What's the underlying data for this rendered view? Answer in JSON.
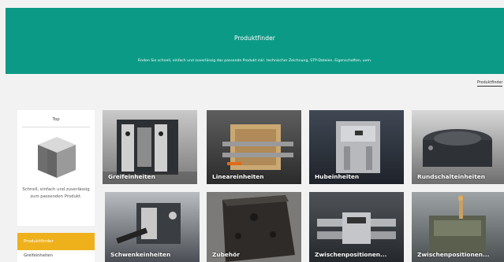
{
  "hero": {
    "title": "Produktfinder",
    "subtitle": "Finden Sie schnell, einfach und zuverlässig das passende Produkt inkl. technischer Zeichnung, STP-Dateien, Eigenschaften, uvm."
  },
  "breadcrumb": {
    "label": "Produktfinder"
  },
  "top_card": {
    "title": "Top",
    "text": "Schnell, einfach und zuverlässig zum passenden Produkt."
  },
  "sidebar": {
    "header": "Produktfinder",
    "items": [
      {
        "label": "Greifeinheiten"
      }
    ]
  },
  "tiles": [
    {
      "label": "Greifeinheiten"
    },
    {
      "label": "Lineareinheiten"
    },
    {
      "label": "Hubeinheiten"
    },
    {
      "label": "Rundschalteinheiten"
    },
    {
      "label": "Schwenkeinheiten"
    },
    {
      "label": "Zubehör"
    },
    {
      "label": "Zwischenpositionen..."
    },
    {
      "label": "Zwischenpositionen..."
    }
  ],
  "colors": {
    "hero": "#0b9a86",
    "accent": "#eeb11c"
  }
}
